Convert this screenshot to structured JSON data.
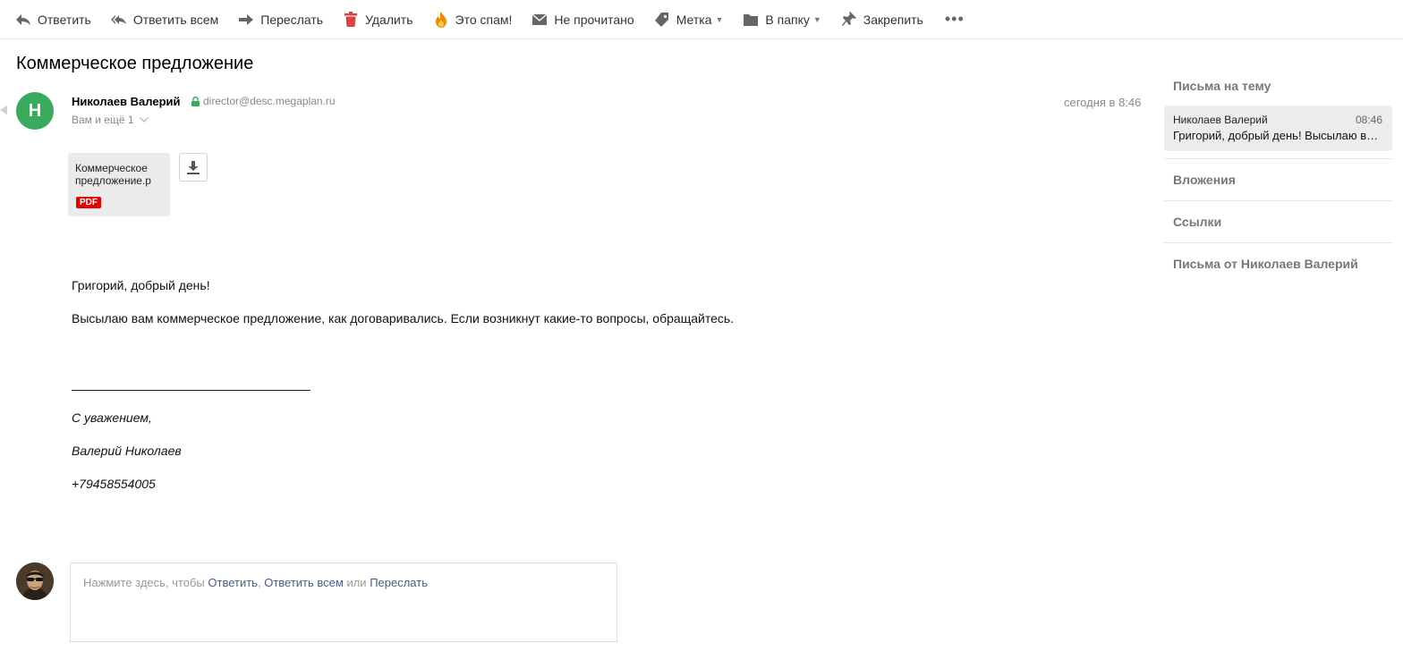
{
  "toolbar": {
    "reply": "Ответить",
    "reply_all": "Ответить всем",
    "forward": "Переслать",
    "delete": "Удалить",
    "spam": "Это спам!",
    "unread": "Не прочитано",
    "label": "Метка",
    "to_folder": "В папку",
    "pin": "Закрепить",
    "more": "•••"
  },
  "message": {
    "subject": "Коммерческое предложение",
    "avatar_letter": "Н",
    "sender_name": "Николаев Валерий",
    "sender_email": "director@desc.megaplan.ru",
    "recipients": "Вам и ещё 1",
    "time": "сегодня в 8:46",
    "attachment": {
      "name": "Коммерческое предложение.р",
      "type": "PDF"
    },
    "greeting": "Григорий, добрый день!",
    "text": "Высылаю вам коммерческое предложение, как договаривались. Если возникнут какие-то вопросы, обращайтесь.",
    "signature": {
      "regards": "С уважением,",
      "name": "Валерий Николаев",
      "phone": "+79458554005"
    }
  },
  "reply_box": {
    "prompt": "Нажмите здесь, чтобы",
    "reply": "Ответить",
    "comma": ",",
    "reply_all": "Ответить всем",
    "or": "или",
    "forward": "Переслать"
  },
  "right_panel": {
    "thread_title": "Письма на тему",
    "thread_items": [
      {
        "sender": "Николаев Валерий",
        "time": "08:46",
        "snippet": "Григорий, добрый день! Высылаю в…"
      }
    ],
    "attachments": "Вложения",
    "links": "Ссылки",
    "from_sender": "Письма от Николаев Валерий"
  },
  "colors": {
    "avatar_bg": "#3aaa5c",
    "pdf_badge": "#e60000",
    "link": "#4a5a8a",
    "delete_icon": "#e04040",
    "spam_icon": "#f08a00"
  }
}
